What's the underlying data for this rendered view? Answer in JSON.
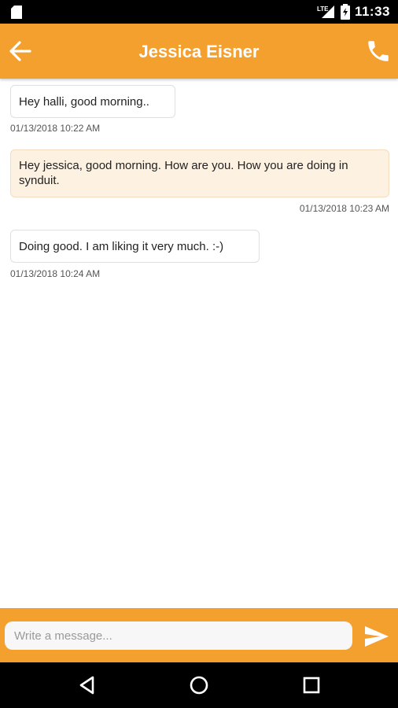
{
  "status_bar": {
    "time": "11:33",
    "network": "LTE"
  },
  "header": {
    "title": "Jessica Eisner"
  },
  "messages": [
    {
      "text": "Hey halli, good morning..",
      "timestamp": "01/13/2018 10:22 AM",
      "direction": "incoming"
    },
    {
      "text": "Hey jessica, good morning. How are you. How you are doing in synduit.",
      "timestamp": "01/13/2018 10:23 AM",
      "direction": "outgoing"
    },
    {
      "text": "Doing good. I am liking it very much. :-)",
      "timestamp": "01/13/2018 10:24 AM",
      "direction": "incoming"
    }
  ],
  "composer": {
    "placeholder": "Write a message...",
    "value": ""
  },
  "icons": {
    "back": "arrow-left-icon",
    "call": "phone-icon",
    "send": "send-icon",
    "nav_back": "triangle-back-icon",
    "nav_home": "circle-home-icon",
    "nav_recents": "square-recents-icon"
  },
  "colors": {
    "accent": "#f4a02f",
    "outgoing_bubble": "#fdf1e2",
    "status_bar": "#000000"
  }
}
